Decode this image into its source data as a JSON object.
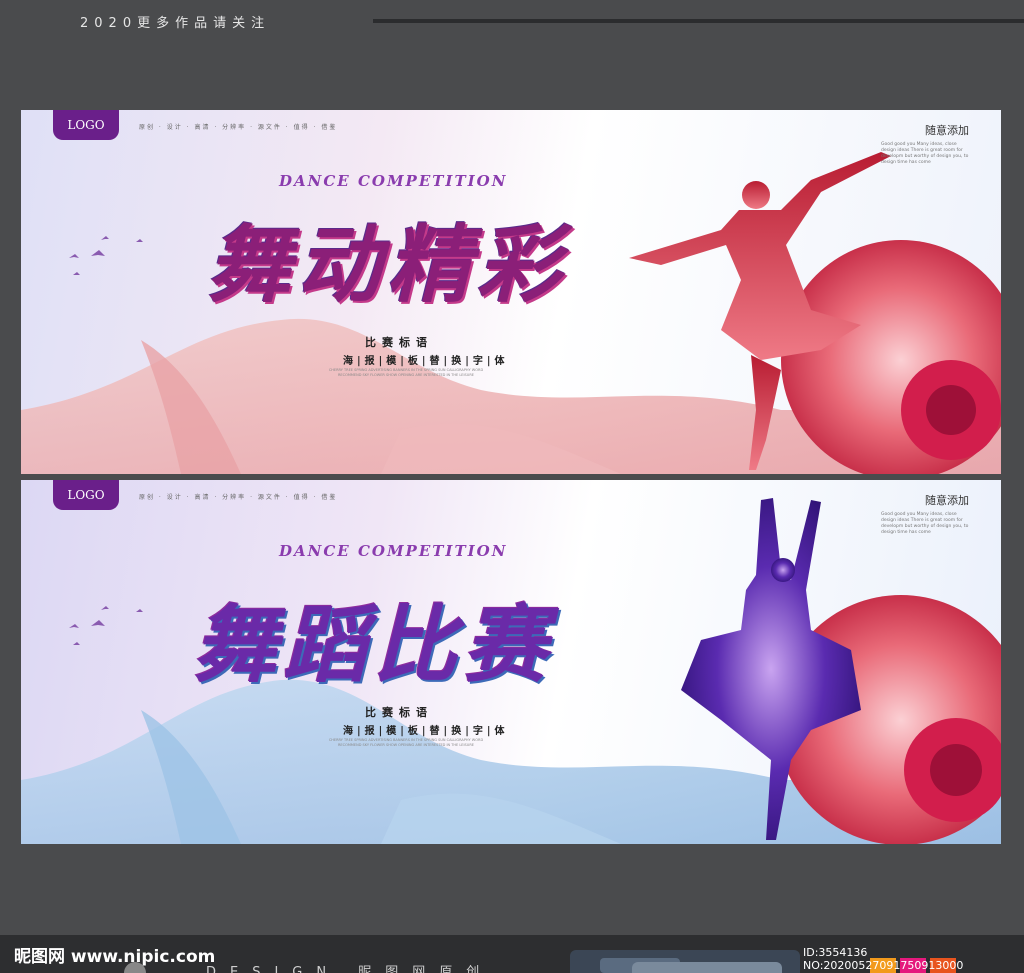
{
  "top": {
    "caption": "2020更多作品请关注"
  },
  "banners": [
    {
      "logo": "LOGO",
      "meta": "原创 · 设计 · 高清 · 分辨率 · 源文件 · 值得 · 借鉴",
      "top_right": "随意添加",
      "small_text": "Good good you Many ideas, close design ideas There is great room for developm but worthy of design you, to design time has come",
      "dance_competition": "DANCE COMPETITION",
      "title": "舞动精彩",
      "subtitle1": "比赛标语",
      "subtitle2": "海|报|模|板|替|换|字|体",
      "tiny_text": "CHERRY TREE SPRING ADVERTISING BANNERS IN THE SPRING SUN CALLIGRAPHY WORD RECOMMEND SKY FLOWER SHOW OPENING ARE INTERESTED IN THE LEISURE"
    },
    {
      "logo": "LOGO",
      "meta": "原创 · 设计 · 高清 · 分辨率 · 源文件 · 值得 · 借鉴",
      "top_right": "随意添加",
      "small_text": "Good good you Many ideas, close design ideas There is great room for developm but worthy of design you, to design time has come",
      "dance_competition": "DANCE COMPETITION",
      "title": "舞蹈比赛",
      "subtitle1": "比赛标语",
      "subtitle2": "海|报|模|板|替|换|字|体",
      "tiny_text": "CHERRY TREE SPRING ADVERTISING BANNERS IN THE SPRING SUN CALLIGRAPHY WORD RECOMMEND SKY FLOWER SHOW OPENING ARE INTERESTED IN THE LEISURE"
    }
  ],
  "footer": {
    "site": "昵图网 www.nipic.com",
    "design": "DESIGN 昵图网原创",
    "id": "ID:3554136 NO:20200527091750913000"
  },
  "colors": {
    "background": "#4a4b4d",
    "logo_purple": "#6a1f8a",
    "swatch_orange": "#f29a1c",
    "swatch_pink": "#e5197d",
    "swatch_red": "#e8541e"
  }
}
